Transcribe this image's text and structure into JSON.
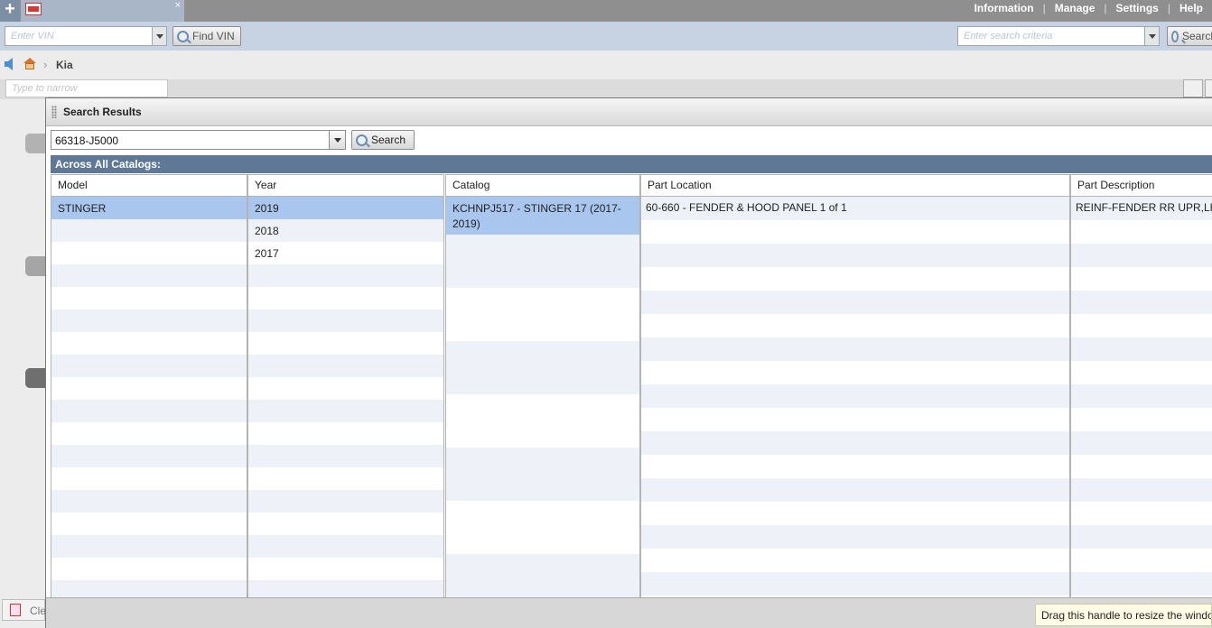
{
  "topbar": {
    "add_tab": "+",
    "tab_close": "×",
    "menu": [
      "Information",
      "Manage",
      "Settings",
      "Help"
    ]
  },
  "vinbar": {
    "vin_placeholder": "Enter VIN",
    "find_vin_label": "Find VIN",
    "search_placeholder": "Enter search criteria",
    "search_label": "Search"
  },
  "breadcrumb": {
    "current": "Kia"
  },
  "filter": {
    "placeholder": "Type to narrow"
  },
  "bottom_tab": {
    "label": "Cle"
  },
  "dialog": {
    "title": "Search Results",
    "query": "66318-J5000",
    "search_button": "Search",
    "section_title": "Across All Catalogs:",
    "columns": [
      "Model",
      "Year",
      "Catalog",
      "Part Location",
      "Part Description"
    ],
    "models": [
      "STINGER"
    ],
    "years": [
      "2019",
      "2018",
      "2017"
    ],
    "catalogs": [
      "KCHNPJ517 - STINGER 17 (2017-2019)"
    ],
    "locations": [
      "60-660 - FENDER & HOOD PANEL 1 of 1"
    ],
    "descriptions": [
      "REINF-FENDER RR UPR,LH"
    ]
  },
  "tooltip": "Drag this handle to resize the window"
}
